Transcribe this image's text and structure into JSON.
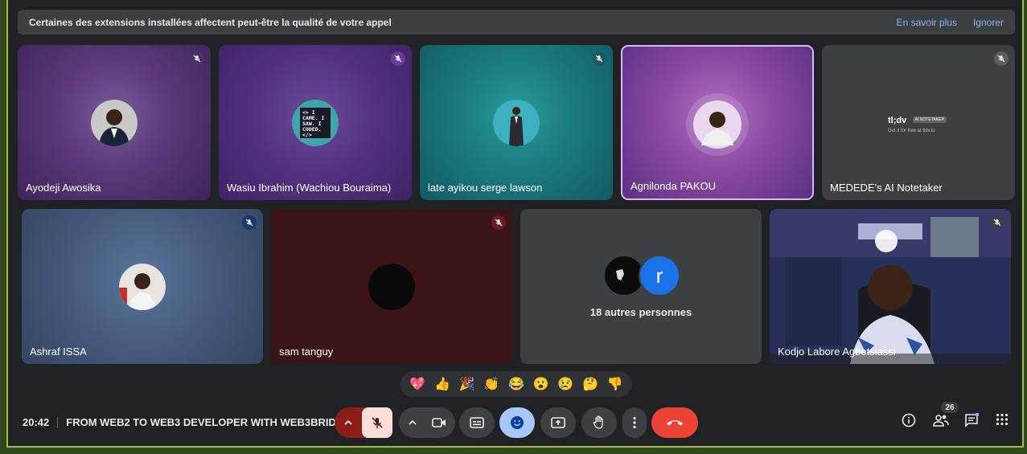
{
  "banner": {
    "message": "Certaines des extensions installées affectent peut-être la qualité de votre appel",
    "learn_more": "En savoir plus",
    "ignore": "Ignorer"
  },
  "participants": [
    {
      "name": "Ayodeji Awosika"
    },
    {
      "name": "Wasiu Ibrahim (Wachiou Bouraima)",
      "avatar_text": "<> I CAME. I SAW. I CODED. </>"
    },
    {
      "name": "late ayikou serge lawson"
    },
    {
      "name": "Agnilonda PAKOU"
    },
    {
      "name": "MEDEDE's AI Notetaker",
      "logo": "tl;dv",
      "logo_badge": "AI NOTETAKER",
      "logo_sub": "Get it for free at tldv.io"
    },
    {
      "name": "Ashraf ISSA"
    },
    {
      "name": "sam tanguy"
    },
    {
      "name": "Kodjo Labore Agbetsiassi"
    }
  ],
  "others": {
    "label": "18 autres personnes",
    "avatar_letter": "r"
  },
  "reactions": [
    "💖",
    "👍",
    "🎉",
    "👏",
    "😂",
    "😮",
    "😢",
    "🤔",
    "👎"
  ],
  "meeting": {
    "time": "20:42",
    "title": "FROM WEB2 TO WEB3 DEVELOPER WITH WEB3BRID..."
  },
  "people_count": "26",
  "colors": {
    "end_call": "#ea4335",
    "mic_off_bg": "#f9dedc",
    "accent_blue": "#8ab4f8",
    "active_emoji_bg": "#a8c7fa"
  }
}
